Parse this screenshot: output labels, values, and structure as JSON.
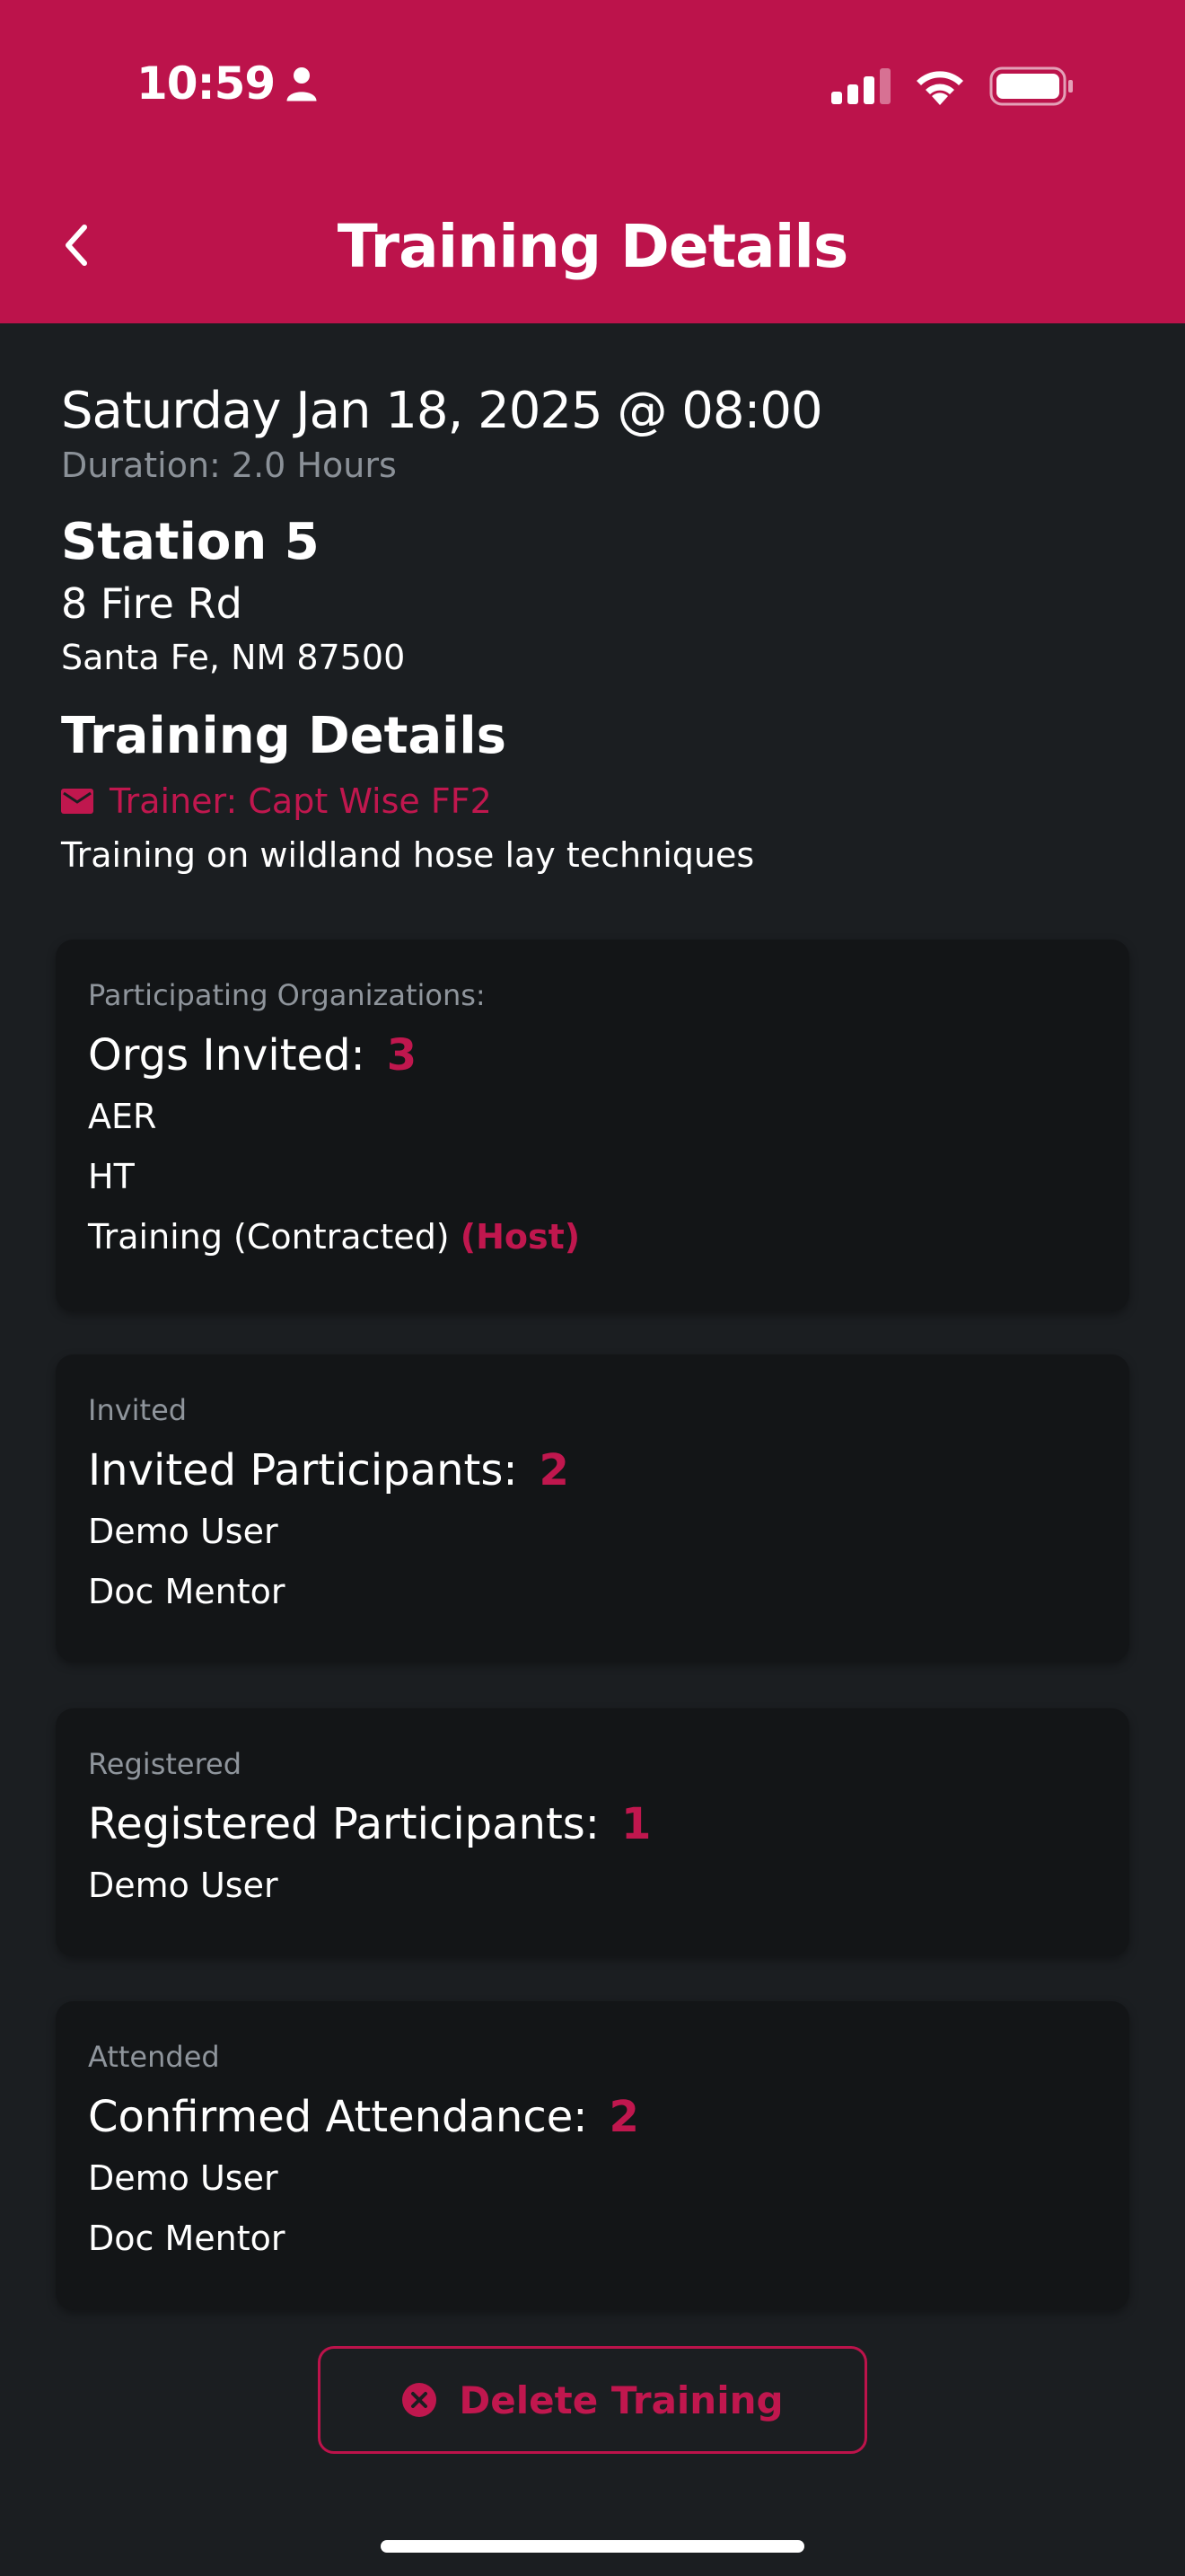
{
  "status_bar": {
    "time": "10:59"
  },
  "header": {
    "title": "Training Details"
  },
  "training": {
    "datetime": "Saturday Jan 18, 2025 @ 08:00",
    "duration": "Duration: 2.0 Hours",
    "station": "Station 5",
    "street": "8 Fire Rd",
    "city": "Santa Fe, NM 87500",
    "details_heading": "Training Details",
    "trainer": "Trainer:  Capt Wise FF2",
    "description": "Training on wildland hose lay techniques"
  },
  "orgs_card": {
    "label": "Participating Organizations:",
    "title": "Orgs Invited:",
    "count": "3",
    "items": [
      "AER",
      "HT",
      "Training (Contracted)"
    ],
    "host_tag": "(Host)"
  },
  "invited_card": {
    "label": "Invited",
    "title": "Invited Participants:",
    "count": "2",
    "items": [
      "Demo User",
      "Doc Mentor"
    ]
  },
  "registered_card": {
    "label": "Registered",
    "title": "Registered Participants:",
    "count": "1",
    "items": [
      "Demo User"
    ]
  },
  "attended_card": {
    "label": "Attended",
    "title": "Confirmed Attendance:",
    "count": "2",
    "items": [
      "Demo User",
      "Doc Mentor"
    ]
  },
  "delete_button": {
    "label": "Delete Training"
  },
  "colors": {
    "accent": "#bc134b",
    "background": "#1b1e21",
    "card": "#131517"
  },
  "icons": [
    "person-icon",
    "signal-icon",
    "wifi-icon",
    "battery-icon",
    "back-chevron-icon",
    "mail-icon",
    "close-circle-icon"
  ]
}
